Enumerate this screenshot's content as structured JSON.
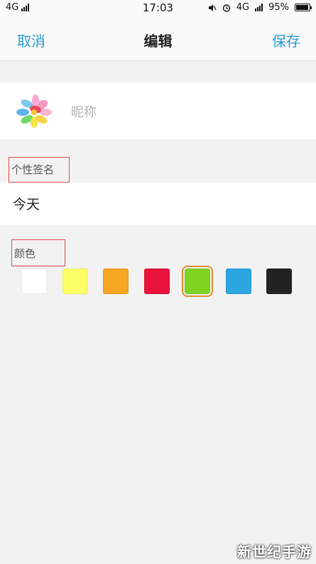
{
  "status_bar": {
    "network_left": "4G",
    "time": "17:03",
    "network_right": "4G",
    "battery": "95%"
  },
  "nav": {
    "cancel": "取消",
    "title": "编辑",
    "save": "保存"
  },
  "profile": {
    "avatar_icon": "flower-petals-icon",
    "nickname_placeholder": "昵称"
  },
  "signature": {
    "label": "个性签名",
    "value": "今天"
  },
  "color": {
    "label": "颜色",
    "selected_index": 4,
    "swatches": [
      {
        "color": "#ffffff"
      },
      {
        "color": "#ffff66"
      },
      {
        "color": "#f5a623"
      },
      {
        "color": "#e8123c"
      },
      {
        "color": "#7ed321"
      },
      {
        "color": "#2ca6e0"
      },
      {
        "color": "#222222"
      }
    ]
  },
  "watermark": "新世纪手游",
  "accent_color": "#2a9bd4",
  "highlight_box_color": "#e0484a"
}
